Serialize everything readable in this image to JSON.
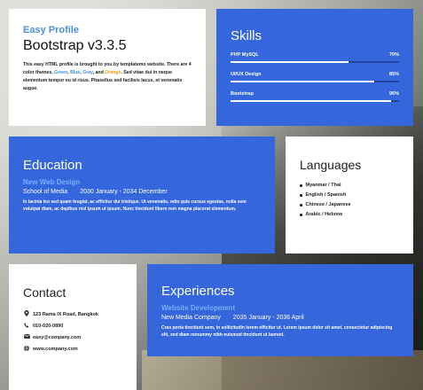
{
  "profile": {
    "subtitle": "Easy Profile",
    "title": "Bootstrap v3.3.5",
    "desc_part1": "This easy HTML profile is brought to you by templatemo website. There are 4 color themes, ",
    "theme_green": "Green",
    "sep1": ", ",
    "theme_blue": "Blue",
    "sep2": ", ",
    "theme_gray": "Gray",
    "sep3": ", and ",
    "theme_orange": "Orange",
    "desc_part2": ". Sed vitae dui in neque elementum tempor eu id risus. Phasellus sed facilisis lacus, et venenatis augue."
  },
  "skills": {
    "heading": "Skills",
    "items": [
      {
        "label": "PHP MySQL",
        "value": "70%",
        "percent": 70
      },
      {
        "label": "UI/UX Design",
        "value": "85%",
        "percent": 85
      },
      {
        "label": "Bootstrap",
        "value": "95%",
        "percent": 95
      }
    ]
  },
  "education": {
    "heading": "Education",
    "subtitle": "New Web Design",
    "place": "School of Media",
    "dates": "2030 January - 2034 December",
    "body": "In lacinia leo sed quam feugiat, ac efficitur dui tristique. Ut venenatis, odio quis cursus egestas, nulla sem volutpat diam, ac dapibus nisl ipsum ut ipsum. Nunc tincidunt libero non magna placerat elementum."
  },
  "languages": {
    "heading": "Languages",
    "items": [
      "Myanmar / Thai",
      "English / Spanish",
      "Chinese / Japanese",
      "Arabic / Hebrew"
    ]
  },
  "contact": {
    "heading": "Contact",
    "items": [
      {
        "icon": "map-marker-icon",
        "text": "123 Rama IX Road, Bangkok"
      },
      {
        "icon": "phone-icon",
        "text": "010-020-0890"
      },
      {
        "icon": "envelope-icon",
        "text": "easy@company.com"
      },
      {
        "icon": "globe-icon",
        "text": "www.company.com"
      }
    ]
  },
  "experiences": {
    "heading": "Experiences",
    "subtitle": "Website Development",
    "place": "New Media Company",
    "dates": "2035 January - 2036 April",
    "body": "Cras porta tincidunt sem, in sollicitudin lorem efficitur ut. Lorem ipsum dolor sit amet, consectetur adipiscing elit, sed diam nonummy nibh euismod tincidunt ut laoreet."
  }
}
